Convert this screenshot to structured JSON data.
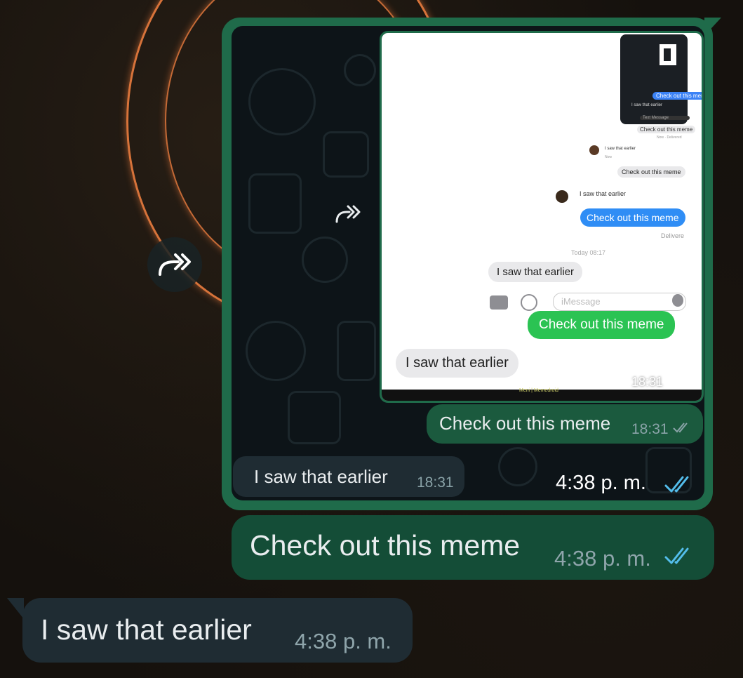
{
  "colors": {
    "outgoing_bubble": "#144d37",
    "incoming_bubble": "#1f2c33",
    "forwarded_frame": "#1f6b4a",
    "read_ticks": "#53bdeb",
    "imessage_blue": "#2f8df5",
    "sms_green": "#2bc353"
  },
  "icons": {
    "forward_button": "forward-icon",
    "read_receipt": "double-check-icon"
  },
  "forwarded_image": {
    "screenshot": {
      "tiny_time": "Today 08:17",
      "tiny_delivered": "Delivere",
      "messages": [
        {
          "text": "Check out this meme",
          "style": "small-gray"
        },
        {
          "text": "I saw that earlier",
          "style": "small-incoming"
        },
        {
          "text": "Check out this meme",
          "style": "imessage-blue"
        },
        {
          "text": "I saw that earlier",
          "style": "gray"
        },
        {
          "text": "Check out this meme",
          "style": "sms-green"
        },
        {
          "text": "I saw that earlier",
          "style": "gray-large"
        }
      ],
      "input_placeholder": "iMessage",
      "footer_text": "Meni | Memedroid",
      "mini_phone_lines": [
        "Check out this meme",
        "I saw that earlier",
        "Text Message"
      ],
      "mini_tiny_status": "Now · Delivered",
      "mini_small_label": "I saw that earlier",
      "mini_small_label_sub": "Now"
    },
    "image_time": "18:31",
    "caption_out": {
      "text": "Check out this meme",
      "time": "18:31"
    },
    "caption_in": {
      "text": "I saw that earlier",
      "time": "18:31"
    },
    "message_time": "4:38 p. m."
  },
  "messages": [
    {
      "direction": "outgoing",
      "text": "Check out this meme",
      "time": "4:38 p. m.",
      "status": "read"
    },
    {
      "direction": "incoming",
      "text": "I saw that earlier",
      "time": "4:38 p. m."
    }
  ]
}
